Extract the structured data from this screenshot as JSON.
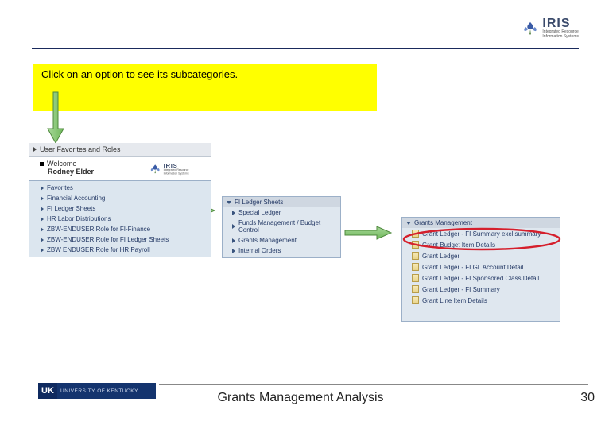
{
  "callout": {
    "text": "Click on an option to see its subcategories."
  },
  "header": {
    "logo_word": "IRIS",
    "logo_tag1": "Integrated Resource",
    "logo_tag2": "Information Systems"
  },
  "panel1": {
    "tab": "User Favorites and Roles",
    "welcome_label": "Welcome",
    "welcome_name": "Rodney Elder",
    "items": [
      "Favorites",
      "Financial Accounting",
      "FI Ledger Sheets",
      "HR Labor Distributions",
      "ZBW-ENDUSER Role for FI-Finance",
      "ZBW-ENDUSER Role for FI Ledger Sheets",
      "ZBW ENDUSER Role for HR Payroll"
    ]
  },
  "panel2": {
    "header": "FI Ledger Sheets",
    "items": [
      "Special Ledger",
      "Funds Management / Budget Control",
      "Grants Management",
      "Internal Orders"
    ]
  },
  "panel3": {
    "header": "Grants Management",
    "items": [
      "Grant Ledger - FI Summary excl summary",
      "Grant Budget Item Details",
      "Grant Ledger",
      "Grant Ledger - FI GL Account Detail",
      "Grant Ledger - FI Sponsored Class Detail",
      "Grant Ledger - FI Summary",
      "Grant Line Item Details"
    ]
  },
  "footer": {
    "uk_mark": "UK",
    "uk_text": "UNIVERSITY OF KENTUCKY",
    "title": "Grants Management Analysis",
    "page": "30"
  }
}
